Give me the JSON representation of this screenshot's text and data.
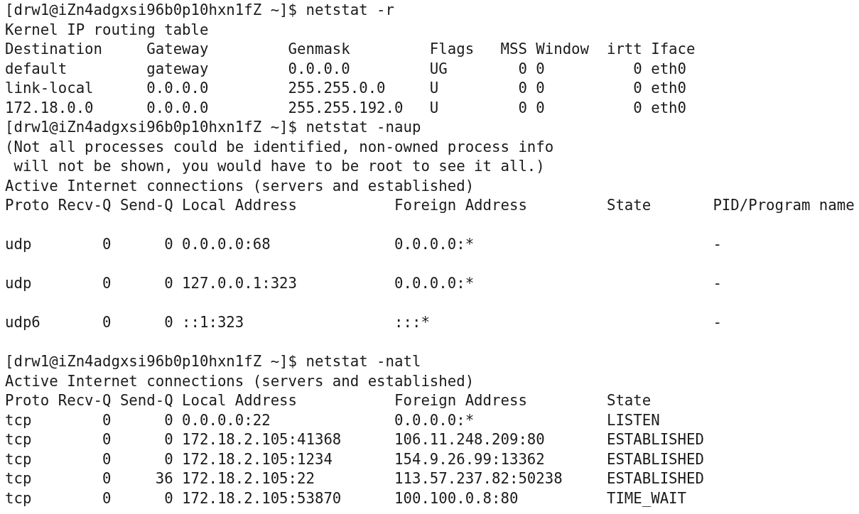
{
  "terminal": {
    "lines": [
      {
        "kind": "prompt",
        "prompt": "[drw1@iZn4adgxsi96b0p10hxn1fZ ~]$",
        "command": "netstat -r"
      },
      {
        "kind": "output",
        "text": "Kernel IP routing table"
      },
      {
        "kind": "output",
        "text": "Destination     Gateway         Genmask         Flags   MSS Window  irtt Iface"
      },
      {
        "kind": "output",
        "text": "default         gateway         0.0.0.0         UG        0 0          0 eth0"
      },
      {
        "kind": "output",
        "text": "link-local      0.0.0.0         255.255.0.0     U         0 0          0 eth0"
      },
      {
        "kind": "output",
        "text": "172.18.0.0      0.0.0.0         255.255.192.0   U         0 0          0 eth0"
      },
      {
        "kind": "prompt",
        "prompt": "[drw1@iZn4adgxsi96b0p10hxn1fZ ~]$",
        "command": "netstat -naup"
      },
      {
        "kind": "output",
        "text": "(Not all processes could be identified, non-owned process info"
      },
      {
        "kind": "output",
        "text": " will not be shown, you would have to be root to see it all.)"
      },
      {
        "kind": "output",
        "text": "Active Internet connections (servers and established)"
      },
      {
        "kind": "output",
        "text": "Proto Recv-Q Send-Q Local Address           Foreign Address         State       PID/Program name"
      },
      {
        "kind": "blank"
      },
      {
        "kind": "output",
        "text": "udp        0      0 0.0.0.0:68              0.0.0.0:*                           -"
      },
      {
        "kind": "blank"
      },
      {
        "kind": "output",
        "text": "udp        0      0 127.0.0.1:323           0.0.0.0:*                           -"
      },
      {
        "kind": "blank"
      },
      {
        "kind": "output",
        "text": "udp6       0      0 ::1:323                 :::*                                -"
      },
      {
        "kind": "blank"
      },
      {
        "kind": "prompt",
        "prompt": "[drw1@iZn4adgxsi96b0p10hxn1fZ ~]$",
        "command": "netstat -natl"
      },
      {
        "kind": "output",
        "text": "Active Internet connections (servers and established)"
      },
      {
        "kind": "output",
        "text": "Proto Recv-Q Send-Q Local Address           Foreign Address         State"
      },
      {
        "kind": "output",
        "text": "tcp        0      0 0.0.0.0:22              0.0.0.0:*               LISTEN"
      },
      {
        "kind": "output",
        "text": "tcp        0      0 172.18.2.105:41368      106.11.248.209:80       ESTABLISHED"
      },
      {
        "kind": "output",
        "text": "tcp        0      0 172.18.2.105:1234       154.9.26.99:13362       ESTABLISHED"
      },
      {
        "kind": "output",
        "text": "tcp        0     36 172.18.2.105:22         113.57.237.82:50238     ESTABLISHED"
      },
      {
        "kind": "output",
        "text": "tcp        0      0 172.18.2.105:53870      100.100.0.8:80          TIME_WAIT"
      }
    ]
  }
}
